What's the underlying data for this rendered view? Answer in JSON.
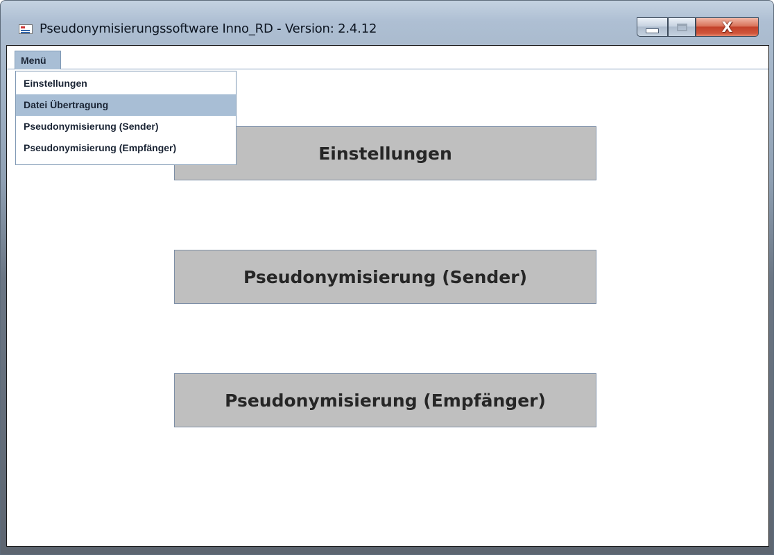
{
  "window": {
    "title": "Pseudonymisierungssoftware Inno_RD - Version: 2.4.12",
    "icon": "application-icon",
    "controls": {
      "minimize_icon": "minimize-icon",
      "maximize_icon": "maximize-icon",
      "close_label": "X"
    }
  },
  "menubar": {
    "menu_label": "Menü"
  },
  "dropdown": {
    "items": [
      {
        "label": "Einstellungen",
        "selected": false
      },
      {
        "label": "Datei Übertragung",
        "selected": true
      },
      {
        "label": "Pseudonymisierung (Sender)",
        "selected": false
      },
      {
        "label": "Pseudonymisierung (Empfänger)",
        "selected": false
      }
    ]
  },
  "main": {
    "buttons": [
      {
        "label": "Einstellungen"
      },
      {
        "label": "Pseudonymisierung (Sender)"
      },
      {
        "label": "Pseudonymisierung (Empfänger)"
      }
    ]
  },
  "colors": {
    "menu_highlight": "#a8bed5",
    "button_fill": "#bfbfbf",
    "button_border": "#7d8ea6"
  }
}
